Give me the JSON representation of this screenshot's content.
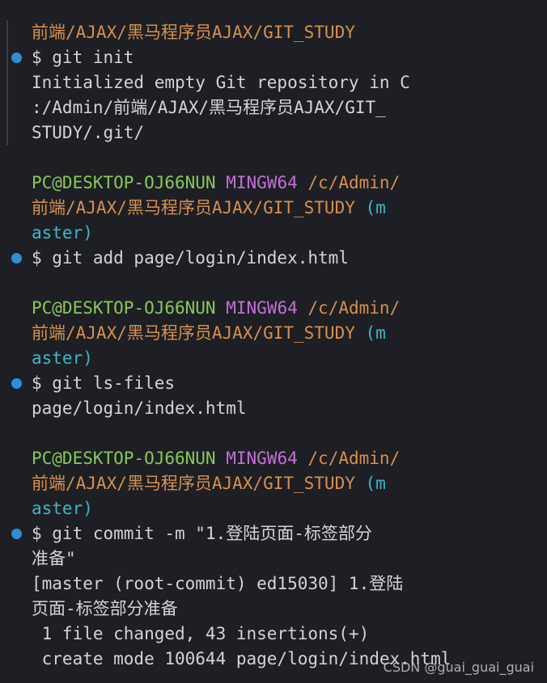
{
  "terminal": {
    "lines": [
      {
        "kind": "path",
        "text": "前端/AJAX/黑马程序员AJAX/GIT_STUDY"
      },
      {
        "kind": "cmd",
        "text": "$ git init"
      },
      {
        "kind": "out",
        "text": "Initialized empty Git repository in C"
      },
      {
        "kind": "out",
        "text": ":/Admin/前端/AJAX/黑马程序员AJAX/GIT_"
      },
      {
        "kind": "out",
        "text": "STUDY/.git/"
      },
      {
        "kind": "blank",
        "text": ""
      },
      {
        "kind": "prompt",
        "user": "PC@DESKTOP-OJ66NUN",
        "ming": "MINGW64",
        "path": "/c/Admin/"
      },
      {
        "kind": "prompt2",
        "path": "前端/AJAX/黑马程序员AJAX/GIT_STUDY",
        "branch": "(m"
      },
      {
        "kind": "branch",
        "text": "aster)"
      },
      {
        "kind": "cmd",
        "text": "$ git add page/login/index.html"
      },
      {
        "kind": "blank",
        "text": ""
      },
      {
        "kind": "prompt",
        "user": "PC@DESKTOP-OJ66NUN",
        "ming": "MINGW64",
        "path": "/c/Admin/"
      },
      {
        "kind": "prompt2",
        "path": "前端/AJAX/黑马程序员AJAX/GIT_STUDY",
        "branch": "(m"
      },
      {
        "kind": "branch",
        "text": "aster)"
      },
      {
        "kind": "cmd",
        "text": "$ git ls-files"
      },
      {
        "kind": "out",
        "text": "page/login/index.html"
      },
      {
        "kind": "blank",
        "text": ""
      },
      {
        "kind": "prompt",
        "user": "PC@DESKTOP-OJ66NUN",
        "ming": "MINGW64",
        "path": "/c/Admin/"
      },
      {
        "kind": "prompt2",
        "path": "前端/AJAX/黑马程序员AJAX/GIT_STUDY",
        "branch": "(m"
      },
      {
        "kind": "branch",
        "text": "aster)"
      },
      {
        "kind": "cmd",
        "text": "$ git commit -m \"1.登陆页面-标签部分"
      },
      {
        "kind": "out",
        "text": "准备\""
      },
      {
        "kind": "out",
        "text": "[master (root-commit) ed15030] 1.登陆"
      },
      {
        "kind": "out",
        "text": "页面-标签部分准备"
      },
      {
        "kind": "out",
        "text": " 1 file changed, 43 insertions(+)"
      },
      {
        "kind": "out",
        "text": " create mode 100644 page/login/index.html"
      }
    ]
  },
  "watermark": "CSDN @guai_guai_guai",
  "colors": {
    "background": "#1e1f24",
    "user": "#89c75a",
    "mingw": "#c46fd6",
    "path": "#d6904e",
    "branch": "#3fb6c7",
    "dot": "#2f8fd2"
  }
}
